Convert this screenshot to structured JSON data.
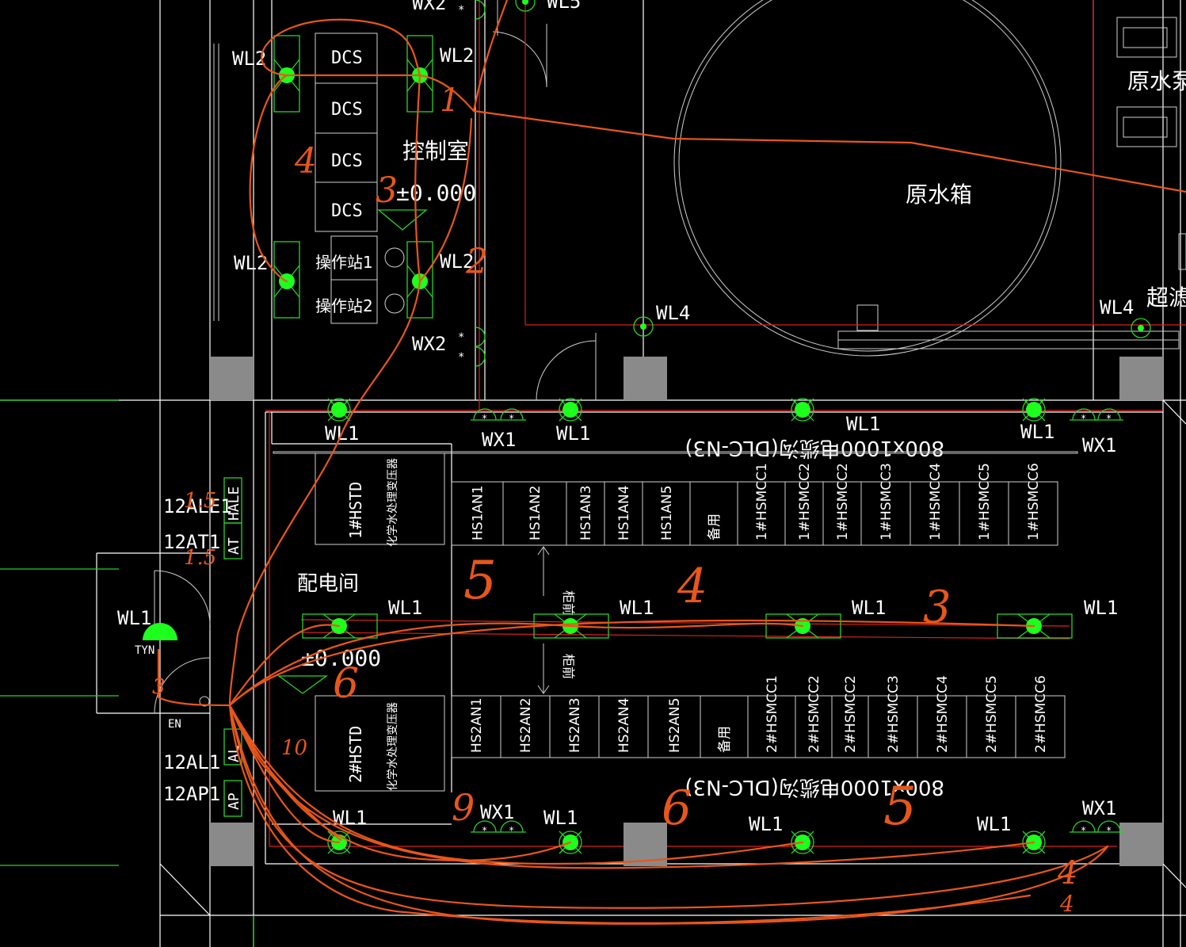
{
  "rooms": {
    "control_room": "控制室",
    "control_level": "±0.000",
    "distribution_room": "配电间",
    "distribution_level": "±0.000",
    "raw_water_tank": "原水箱",
    "raw_water_pump": "原水泵",
    "ultrafiltration": "超滤"
  },
  "cabinets_control": [
    "DCS",
    "DCS",
    "DCS",
    "DCS"
  ],
  "operator_stations": [
    "操作站1",
    "操作站2"
  ],
  "circuits": {
    "wl1": "WL1",
    "wl2": "WL2",
    "wl4": "WL4",
    "wl5": "WL5",
    "wx1": "WX1",
    "wx2": "WX2",
    "tyn": "TYN",
    "en": "EN"
  },
  "panels_left": {
    "ale": "12ALE1",
    "at": "12AT1",
    "al": "12AL1",
    "ap": "12AP1",
    "hale": "HALE",
    "at_tag": "AT",
    "al_tag": "AL",
    "ap_tag": "AP"
  },
  "transformers": [
    {
      "name": "1#HSTD",
      "desc": "化学水处理变压器"
    },
    {
      "name": "2#HSTD",
      "desc": "化学水处理变压器"
    }
  ],
  "switchgear_row1": [
    "HS1AN1",
    "HS1AN2",
    "HS1AN3",
    "HS1AN4",
    "HS1AN5",
    "备用",
    "1#HSMCC1",
    "1#HSMCC2",
    "1#HSMCC2",
    "1#HSMCC3",
    "1#HSMCC4",
    "1#HSMCC5",
    "1#HSMCC6"
  ],
  "switchgear_row2": [
    "HS2AN1",
    "HS2AN2",
    "HS2AN3",
    "HS2AN4",
    "HS2AN5",
    "备用",
    "2#HSMCC1",
    "2#HSMCC2",
    "2#HSMCC2",
    "2#HSMCC3",
    "2#HSMCC4",
    "2#HSMCC5",
    "2#HSMCC6"
  ],
  "trench_label": "800x1000电缆沟(DLC-N3)",
  "cabinet_front": "柜前",
  "handwritten": [
    "4",
    "3",
    "2",
    "1",
    "5",
    "4",
    "3",
    "1.5",
    "1.5",
    "10",
    "9",
    "6",
    "5",
    "4",
    "4",
    "3"
  ],
  "colors": {
    "background": "#000000",
    "wall": "#ffffff",
    "red_line": "#d92020",
    "green_fixture": "#27d327",
    "lamp": "#1dff1d",
    "annotation_orange": "#e8561a",
    "column": "#8a8a8a"
  }
}
